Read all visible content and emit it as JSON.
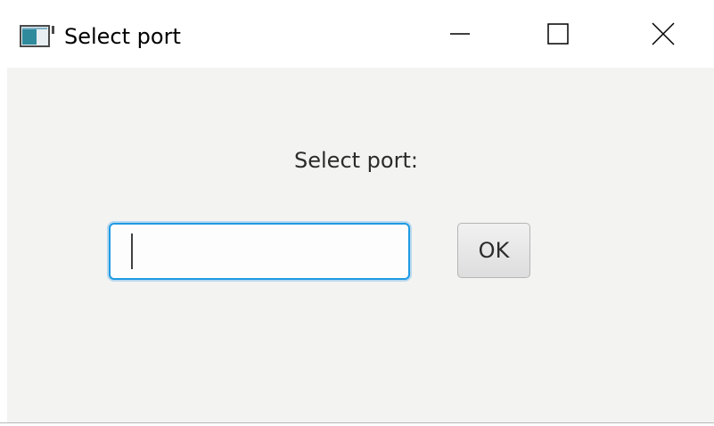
{
  "window": {
    "title": "Select port",
    "icon": "app-window-icon",
    "controls": {
      "minimize_icon": "minimize-icon",
      "maximize_icon": "maximize-icon",
      "close_icon": "close-icon"
    }
  },
  "dialog": {
    "prompt": "Select port:",
    "port_value": "",
    "ok_label": "OK"
  },
  "colors": {
    "content_background": "#f3f3f1",
    "input_focus_border": "#1e9ae3",
    "text": "#2b2b2b"
  }
}
